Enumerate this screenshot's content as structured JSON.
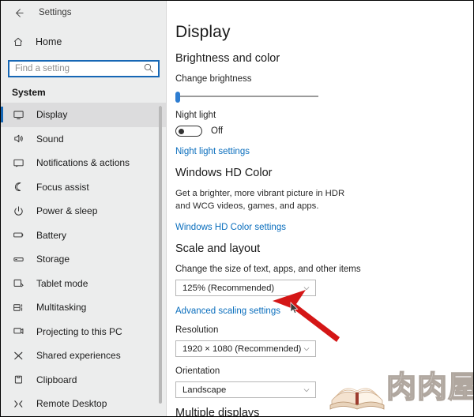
{
  "window": {
    "title": "Settings",
    "back_icon": "back-arrow-icon"
  },
  "sidebar": {
    "home_label": "Home",
    "home_icon": "home-icon",
    "search": {
      "placeholder": "Find a setting",
      "value": "",
      "icon": "search-icon"
    },
    "section_title": "System",
    "selected": "Display",
    "accent_color": "#1667b5",
    "background_color": "#eceded",
    "items": [
      {
        "label": "Display",
        "icon": "monitor-icon",
        "selected": true
      },
      {
        "label": "Sound",
        "icon": "speaker-icon",
        "selected": false
      },
      {
        "label": "Notifications & actions",
        "icon": "notification-icon",
        "selected": false
      },
      {
        "label": "Focus assist",
        "icon": "moon-icon",
        "selected": false
      },
      {
        "label": "Power & sleep",
        "icon": "power-icon",
        "selected": false
      },
      {
        "label": "Battery",
        "icon": "battery-icon",
        "selected": false
      },
      {
        "label": "Storage",
        "icon": "storage-icon",
        "selected": false
      },
      {
        "label": "Tablet mode",
        "icon": "tablet-icon",
        "selected": false
      },
      {
        "label": "Multitasking",
        "icon": "multitasking-icon",
        "selected": false
      },
      {
        "label": "Projecting to this PC",
        "icon": "projecting-icon",
        "selected": false
      },
      {
        "label": "Shared experiences",
        "icon": "shared-experiences-icon",
        "selected": false
      },
      {
        "label": "Clipboard",
        "icon": "clipboard-icon",
        "selected": false
      },
      {
        "label": "Remote Desktop",
        "icon": "remote-desktop-icon",
        "selected": false
      }
    ]
  },
  "main": {
    "page_title": "Display",
    "brightness_section": {
      "heading": "Brightness and color",
      "slider_label": "Change brightness",
      "slider_value": 0,
      "slider_color": "#2e7dd1"
    },
    "night_light": {
      "label": "Night light",
      "state": "Off",
      "enabled": false,
      "link": "Night light settings"
    },
    "hd_color": {
      "heading": "Windows HD Color",
      "description": "Get a brighter, more vibrant picture in HDR and WCG videos, games, and apps.",
      "link": "Windows HD Color settings"
    },
    "scale_layout": {
      "heading": "Scale and layout",
      "scale_label": "Change the size of text, apps, and other items",
      "scale_value": "125% (Recommended)",
      "advanced_link": "Advanced scaling settings",
      "resolution_label": "Resolution",
      "resolution_value": "1920 × 1080 (Recommended)",
      "orientation_label": "Orientation",
      "orientation_value": "Landscape"
    },
    "multiple_displays": {
      "heading": "Multiple displays"
    }
  },
  "annotations": {
    "arrow_color": "#d41616",
    "arrow_target": "Advanced scaling settings",
    "cursor_icon": "mouse-pointer-icon"
  },
  "watermark": {
    "text": "肉肉屋",
    "icon": "open-book-icon"
  },
  "link_color": "#0a6ebd"
}
